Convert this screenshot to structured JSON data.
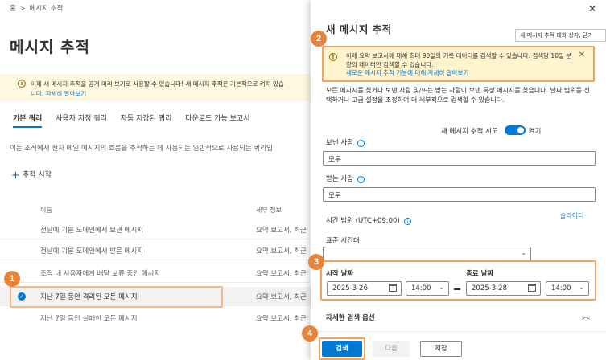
{
  "breadcrumb": {
    "home": "홈",
    "current": "메시지 추적"
  },
  "page": {
    "title": "메시지 추적",
    "banner": {
      "text": "이제 새 메시지 추적을 공개 미리 보기로 사용할 수 있습니다! 새 메시지 추적은 기본적으로 켜져 있습",
      "link": "니다. 자세히 알아보기"
    },
    "tabs": [
      "기본 쿼리",
      "사용자 지정 쿼리",
      "자동 저장된 쿼리",
      "다운로드 가능 보고서"
    ],
    "description": "이는 조직에서 전자 메일 메시지의 흐름을 추적하는 데 사용되는 일반적으로 사용되는 쿼리입",
    "start_trace": "추적 시작",
    "columns": {
      "name": "이름",
      "detail": "세부 정보"
    },
    "rows": [
      {
        "name": "전날에 기본 도메인에서 보낸 메시지",
        "detail": "요약 보고서, 최근"
      },
      {
        "name": "전날에 기본 도메인에서 받은 메시지",
        "detail": "요약 보고서, 최근"
      },
      {
        "name": "조직 내 사용자에게 배달 보류 중인 메시지",
        "detail": "요약 보고서, 최근"
      },
      {
        "name": "지난 7일 동안 격리된 모든 메시지",
        "detail": "요약 보고서, 최근"
      },
      {
        "name": "지난 7일 동안 실패한 모든 메시지",
        "detail": "요약 보고서, 최근"
      }
    ]
  },
  "panel": {
    "title": "새 메시지 추적",
    "tooltip": "새 메시지 추적 대화 상자, 닫기",
    "warning": {
      "text": "이제 요약 보고서에 대해 최대 90일의 기록 데이터를 검색할 수 있습니다. 검색당 10일 분량의 데이터만 검색할 수 있습니다.",
      "link": "새로운 메시지 추적 기능에 대해 자세히 알아보기"
    },
    "description": "모든 메시지를 찾거나 보낸 사람 및/또는 받는 사람이 보낸 특정 메시지를 찾습니다. 날짜 범위를 선택하거나 고급 설정을 조정하여 더 세부적으로 검색할 수 있습니다.",
    "toggle": {
      "label": "새 메시지 추적 시도",
      "state": "켜기"
    },
    "sender": {
      "label": "보낸 사람",
      "value": "모두"
    },
    "recipient": {
      "label": "받는 사람",
      "value": "모두"
    },
    "time_range": {
      "label": "시간 범위 (UTC+09:00)",
      "slider_link": "슬라이더"
    },
    "timezone": {
      "label": "표준 시간대",
      "value": ""
    },
    "start": {
      "label": "시작 날짜",
      "date": "2025-3-26",
      "time": "14:00"
    },
    "end": {
      "label": "종료 날짜",
      "date": "2025-3-28",
      "time": "14:00"
    },
    "advanced": "자세한 검색 옵션",
    "buttons": {
      "search": "검색",
      "next": "다음",
      "save": "저장"
    }
  },
  "callouts": [
    "1",
    "2",
    "3",
    "4"
  ],
  "colors": {
    "accent": "#0078d4",
    "callout": "#e8833a",
    "highlight": "#f5a25d"
  }
}
